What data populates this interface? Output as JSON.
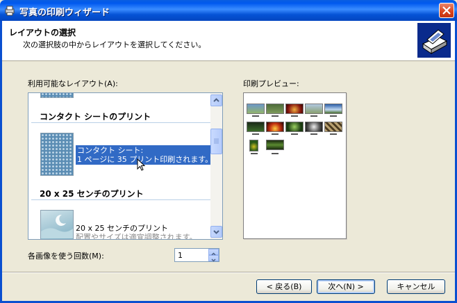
{
  "window": {
    "title": "写真の印刷ウィザード"
  },
  "header": {
    "title": "レイアウトの選択",
    "subtitle": "次の選択肢の中からレイアウトを選択してください。"
  },
  "layouts": {
    "label": "利用可能なレイアウト(A):",
    "sections": [
      {
        "title": "コンタクト シートのプリント",
        "items": [
          {
            "line1": "コンタクト シート:",
            "line2": "1 ページに 35 プリント印刷されます。",
            "selected": true
          }
        ]
      },
      {
        "title": "20 x 25 センチのプリント",
        "items": [
          {
            "line1": "20 x 25 センチのプリント",
            "line2": "配置やサイズは適宜調整されます。",
            "selected": false
          }
        ]
      }
    ]
  },
  "preview": {
    "label": "印刷プレビュー:",
    "thumbnails": 12
  },
  "copies": {
    "label": "各画像を使う回数(M):",
    "value": "1"
  },
  "buttons": {
    "back": "< 戻る(B)",
    "next": "次へ(N) >",
    "cancel": "キャンセル"
  },
  "colors": {
    "selection": "#316ac5",
    "titlebar": "#0058ee"
  }
}
